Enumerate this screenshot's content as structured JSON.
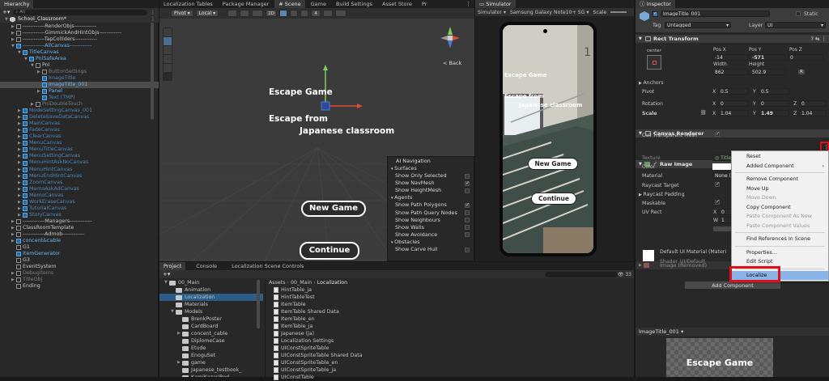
{
  "colors": {
    "accent": "#2c5d87",
    "highlight_red": "#e0101a",
    "menu_selected": "#8ab4e8",
    "hierarchy_blue": "#58a8e8"
  },
  "hierarchy": {
    "tab_label": "Hierarchy",
    "add_label": "+▾",
    "search_placeholder": "All",
    "scene_name": "School_Classroom*",
    "rows": [
      {
        "label": "------------RenderObjs------------",
        "indent": 1,
        "arrow": "▶",
        "style": "normal"
      },
      {
        "label": "------------GimmickAndHintObjs------------",
        "indent": 1,
        "arrow": "▶",
        "style": "normal"
      },
      {
        "label": "------------TapColliders------------",
        "indent": 1,
        "arrow": "▶",
        "style": "normal"
      },
      {
        "label": "------------AllCanvas------------",
        "indent": 1,
        "arrow": "▼",
        "style": "blue"
      },
      {
        "label": "TitleCanvas",
        "indent": 2,
        "arrow": "▼",
        "style": "blue"
      },
      {
        "label": "PnlSafeArea",
        "indent": 3,
        "arrow": "▼",
        "style": "blue"
      },
      {
        "label": "Pnl",
        "indent": 4,
        "arrow": "▼",
        "style": "normal"
      },
      {
        "label": "ButtonSettings",
        "indent": 5,
        "arrow": "▶",
        "style": "dim"
      },
      {
        "label": "ImageTitle",
        "indent": 5,
        "arrow": "",
        "style": "dimblue"
      },
      {
        "label": "ImageTitle_001",
        "indent": 5,
        "arrow": "",
        "style": "selected"
      },
      {
        "label": "Panel",
        "indent": 5,
        "arrow": "▶",
        "style": "blue"
      },
      {
        "label": "Text (TMP)",
        "indent": 5,
        "arrow": "",
        "style": "dimblue"
      },
      {
        "label": "PnlDoubleTouch",
        "indent": 4,
        "arrow": "▶",
        "style": "dim"
      },
      {
        "label": "ModeSettingCanvas_001",
        "indent": 2,
        "arrow": "▶",
        "style": "dimblue"
      },
      {
        "label": "DeleteSaveDataCanvas",
        "indent": 2,
        "arrow": "▶",
        "style": "dimblue"
      },
      {
        "label": "MainCanvas",
        "indent": 2,
        "arrow": "▶",
        "style": "dimblue"
      },
      {
        "label": "FadeCanvas",
        "indent": 2,
        "arrow": "▶",
        "style": "dimblue"
      },
      {
        "label": "ClearCanvas",
        "indent": 2,
        "arrow": "▶",
        "style": "dimblue"
      },
      {
        "label": "MenuCanvas",
        "indent": 2,
        "arrow": "▶",
        "style": "dimblue"
      },
      {
        "label": "MenuTitleCanvas",
        "indent": 2,
        "arrow": "▶",
        "style": "dimblue"
      },
      {
        "label": "MenuSettingCanvas",
        "indent": 2,
        "arrow": "▶",
        "style": "dimblue"
      },
      {
        "label": "MenuHintAskNoCanvas",
        "indent": 2,
        "arrow": "▶",
        "style": "dimblue"
      },
      {
        "label": "MenuHintCanvas",
        "indent": 2,
        "arrow": "▶",
        "style": "dimblue"
      },
      {
        "label": "MenuEndHintCanvas",
        "indent": 2,
        "arrow": "▶",
        "style": "dimblue"
      },
      {
        "label": "ZoomCanvas",
        "indent": 2,
        "arrow": "▶",
        "style": "dimblue"
      },
      {
        "label": "MemoAskAdCanvas",
        "indent": 2,
        "arrow": "▶",
        "style": "dimblue"
      },
      {
        "label": "MemoCanvas",
        "indent": 2,
        "arrow": "▶",
        "style": "dimblue"
      },
      {
        "label": "WorkEraseCanvas",
        "indent": 2,
        "arrow": "▶",
        "style": "dimblue"
      },
      {
        "label": "TutorialCanvas",
        "indent": 2,
        "arrow": "▶",
        "style": "dimblue"
      },
      {
        "label": "StoryCanvas",
        "indent": 2,
        "arrow": "▶",
        "style": "dimblue"
      },
      {
        "label": "------------Managers------------",
        "indent": 1,
        "arrow": "▶",
        "style": "normal"
      },
      {
        "label": "ClassRoomTemplate",
        "indent": 1,
        "arrow": "▶",
        "style": "normal"
      },
      {
        "label": "------------Admob------------",
        "indent": 1,
        "arrow": "▶",
        "style": "normal"
      },
      {
        "label": "concent&cable",
        "indent": 1,
        "arrow": "▶",
        "style": "blue"
      },
      {
        "label": "G1",
        "indent": 1,
        "arrow": "",
        "style": "normal"
      },
      {
        "label": "ItemGenerator",
        "indent": 1,
        "arrow": "",
        "style": "blue"
      },
      {
        "label": "G3",
        "indent": 1,
        "arrow": "",
        "style": "normal"
      },
      {
        "label": "EventSystem",
        "indent": 1,
        "arrow": "",
        "style": "normal"
      },
      {
        "label": "Debugitems",
        "indent": 1,
        "arrow": "▶",
        "style": "dim"
      },
      {
        "label": "TitleObj",
        "indent": 1,
        "arrow": "▶",
        "style": "dim"
      },
      {
        "label": "Ending",
        "indent": 1,
        "arrow": "",
        "style": "normal"
      }
    ]
  },
  "scene": {
    "tabs": [
      "Localization Tables",
      "Package Manager",
      "# Scene",
      "Game",
      "Build Settings",
      "Asset Store",
      "Pr"
    ],
    "active_tab_index": 2,
    "toolbar": {
      "pivot": "Pivot",
      "local": "Local",
      "mode2d": "2D",
      "gizmo_count": "4"
    },
    "back_label": "< Back",
    "gizmo_axis": {
      "x": "x",
      "y": "y",
      "z": "z"
    },
    "texts": {
      "escape_game": "Escape Game",
      "escape_from": "Escape from",
      "japanese_classroom": "Japanese classroom",
      "new_game": "New Game",
      "continue": "Continue"
    },
    "ai_nav": {
      "title": "AI Navigation",
      "surfaces_header": "Surfaces",
      "surfaces": [
        {
          "label": "Show Only Selected",
          "checked": false
        },
        {
          "label": "Show NavMesh",
          "checked": true
        },
        {
          "label": "Show HeightMesh",
          "checked": false
        }
      ],
      "agents_header": "Agents",
      "agents": [
        {
          "label": "Show Path Polygons",
          "checked": true
        },
        {
          "label": "Show Path Query Nodes",
          "checked": false
        },
        {
          "label": "Show Neighbours",
          "checked": false
        },
        {
          "label": "Show Walls",
          "checked": false
        },
        {
          "label": "Show Avoidance",
          "checked": false
        }
      ],
      "obstacles_header": "Obstacles",
      "obstacles": [
        {
          "label": "Show Carve Hull",
          "checked": false
        }
      ]
    }
  },
  "simulator": {
    "tab_label": "Simulator",
    "mode": "Simulator",
    "device": "Samsung Galaxy Note10+ 5G",
    "scale_label": "Scale",
    "escape_game": "Escape Game",
    "escape_from": "Escape from",
    "japanese_classroom": "Japanese classroom",
    "new_game": "New Game",
    "continue": "Continue"
  },
  "project": {
    "tabs": [
      "Project",
      "Console",
      "Localization Scene Controls"
    ],
    "active_tab_index": 0,
    "add_label": "+▾",
    "breadcrumb": [
      "Assets",
      "00_Main",
      "Localization"
    ],
    "count": "33",
    "folders": [
      {
        "label": "00_Main",
        "indent": 0,
        "arrow": "▼"
      },
      {
        "label": "Animation",
        "indent": 1,
        "arrow": ""
      },
      {
        "label": "Localization",
        "indent": 1,
        "arrow": "",
        "selected": true
      },
      {
        "label": "Materials",
        "indent": 1,
        "arrow": ""
      },
      {
        "label": "Models",
        "indent": 1,
        "arrow": "▼"
      },
      {
        "label": "BrenkPoster",
        "indent": 2,
        "arrow": ""
      },
      {
        "label": "CardBoard",
        "indent": 2,
        "arrow": ""
      },
      {
        "label": "concent_cable",
        "indent": 2,
        "arrow": "▶"
      },
      {
        "label": "DiplomeCase",
        "indent": 2,
        "arrow": ""
      },
      {
        "label": "Etude",
        "indent": 2,
        "arrow": ""
      },
      {
        "label": "EnoguSet",
        "indent": 2,
        "arrow": ""
      },
      {
        "label": "game",
        "indent": 2,
        "arrow": "▶"
      },
      {
        "label": "Japanese_testbook_",
        "indent": 2,
        "arrow": ""
      },
      {
        "label": "KamiKazariRed",
        "indent": 2,
        "arrow": ""
      }
    ],
    "files": [
      "HintTable_ja",
      "HintTableTest",
      "ItemTable",
      "ItemTable Shared Data",
      "ItemTable_en",
      "ItemTable_ja",
      "Japanese (ja)",
      "Localization Settings",
      "UIConstSpriteTable",
      "UIConstSpriteTable Shared Data",
      "UIConstSpriteTable_en",
      "UIConstSpriteTable_ja",
      "UIConstTable"
    ]
  },
  "inspector": {
    "tab_label": "Inspector",
    "object_name": "ImageTitle_001",
    "static_label": "Static",
    "tag_label": "Tag",
    "tag_value": "Untagged",
    "layer_label": "Layer",
    "layer_value": "UI",
    "rect_transform": {
      "title": "Rect Transform",
      "anchor_label": "center",
      "pos_x_label": "Pos X",
      "pos_y_label": "Pos Y",
      "pos_z_label": "Pos Z",
      "pos_x": "-14",
      "pos_y": "-571",
      "pos_z": "0",
      "width_label": "Width",
      "height_label": "Height",
      "width": "862",
      "height": "502.9",
      "anchors_label": "Anchors",
      "pivot_label": "Pivot",
      "pivot_x": "0.5",
      "pivot_y": "0.5",
      "rotation_label": "Rotation",
      "rot_x": "0",
      "rot_y": "0",
      "rot_z": "0",
      "scale_label": "Scale",
      "scale_x": "1.04",
      "scale_y": "1.49",
      "scale_z": "1.04",
      "x": "X",
      "y": "Y",
      "z": "Z",
      "r": "R"
    },
    "canvas_renderer": {
      "title": "Canvas Renderer",
      "cull_label": "Cull Transparent Mesh"
    },
    "raw_image": {
      "title": "Raw Image",
      "texture_label": "Texture",
      "texture_value": "Title",
      "color_label": "Color",
      "material_label": "Material",
      "material_value": "None (M",
      "raycast_target_label": "Raycast Target",
      "raycast_padding_label": "Raycast Padding",
      "maskable_label": "Maskable",
      "uvrect_label": "UV Rect",
      "uv_x": "0",
      "uv_w": "1",
      "x": "X",
      "w": "W"
    },
    "image_removed_label": "Image (Removed)",
    "default_material": "Default UI Material (Materi",
    "shader_label": "Shader",
    "shader_value": "UI/Default",
    "add_component": "Add Component",
    "preview_label": "ImageTitle_001 ▾",
    "preview_text": "Escape Game"
  },
  "context_menu": {
    "items": [
      {
        "label": "Reset",
        "disabled": false,
        "sub": false
      },
      {
        "label": "Added Component",
        "disabled": false,
        "sub": true
      },
      {
        "sep": true
      },
      {
        "label": "Remove Component",
        "disabled": false,
        "sub": false
      },
      {
        "label": "Move Up",
        "disabled": false,
        "sub": false
      },
      {
        "label": "Move Down",
        "disabled": true,
        "sub": false
      },
      {
        "label": "Copy Component",
        "disabled": false,
        "sub": false
      },
      {
        "label": "Paste Component As New",
        "disabled": true,
        "sub": false
      },
      {
        "label": "Paste Component Values",
        "disabled": true,
        "sub": false
      },
      {
        "sep": true
      },
      {
        "label": "Find References In Scene",
        "disabled": false,
        "sub": false
      },
      {
        "sep": true
      },
      {
        "label": "Properties...",
        "disabled": false,
        "sub": false
      },
      {
        "label": "Edit Script",
        "disabled": false,
        "sub": false
      },
      {
        "sep": true
      },
      {
        "label": "Localize",
        "disabled": false,
        "sub": false,
        "selected": true
      }
    ]
  }
}
